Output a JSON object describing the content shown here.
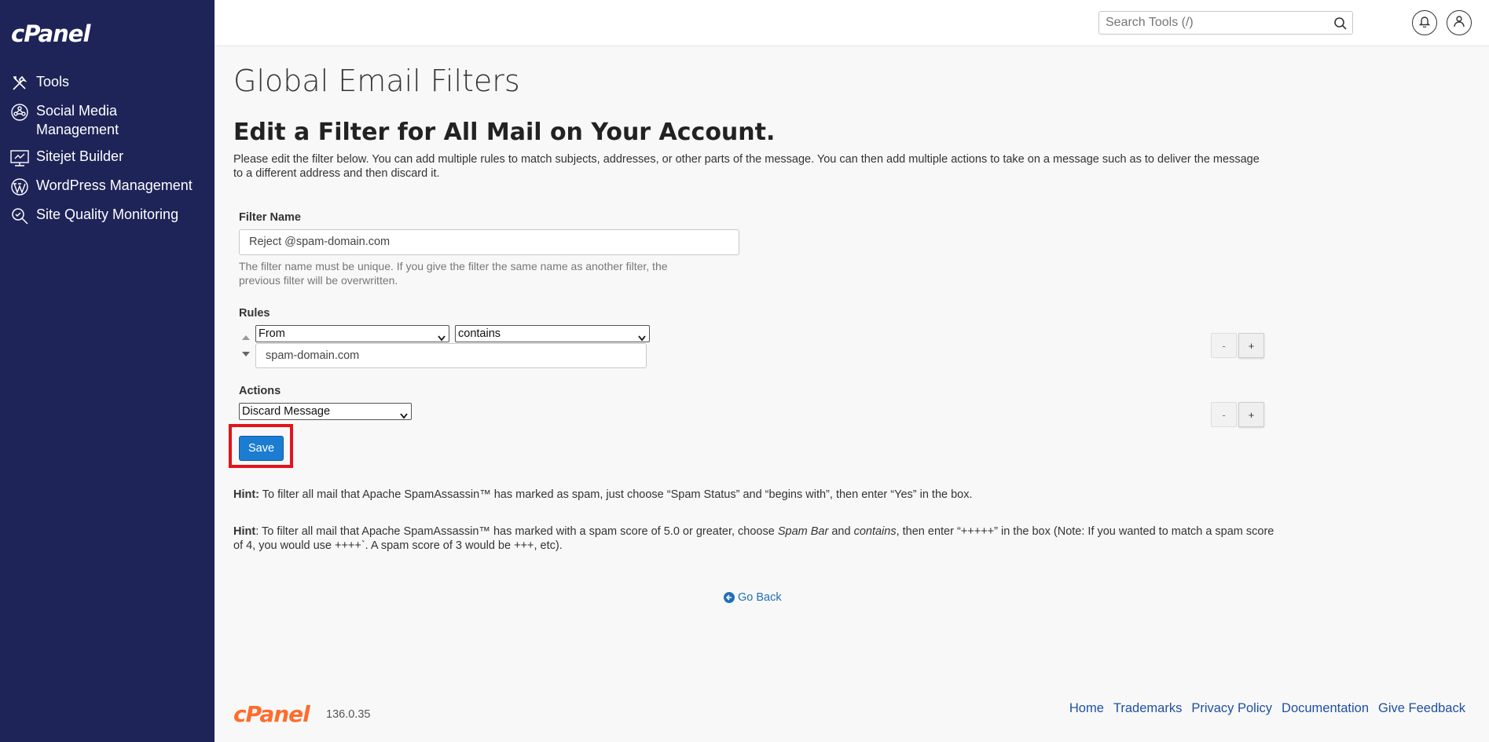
{
  "brand": {
    "logo": "cPanel",
    "version": "136.0.35"
  },
  "sidebar": {
    "items": [
      {
        "label": "Tools",
        "icon": "tools-icon"
      },
      {
        "label": "Social Media Management",
        "icon": "social-media-icon"
      },
      {
        "label": "Sitejet Builder",
        "icon": "sitejet-icon"
      },
      {
        "label": "WordPress Management",
        "icon": "wordpress-icon"
      },
      {
        "label": "Site Quality Monitoring",
        "icon": "site-quality-icon"
      }
    ]
  },
  "header": {
    "search_placeholder": "Search Tools (/)"
  },
  "page": {
    "title": "Global Email Filters",
    "subtitle": "Edit a Filter for All Mail on Your Account.",
    "intro": "Please edit the filter below. You can add multiple rules to match subjects, addresses, or other parts of the message. You can then add multiple actions to take on a message such as to deliver the message to a different address and then discard it."
  },
  "form": {
    "filter_name_label": "Filter Name",
    "filter_name_value": "Reject @spam-domain.com",
    "filter_name_help": "The filter name must be unique. If you give the filter the same name as another filter, the previous filter will be overwritten.",
    "rules_label": "Rules",
    "rule_part": "From",
    "rule_match": "contains",
    "rule_value": "spam-domain.com",
    "actions_label": "Actions",
    "action_value": "Discard Message",
    "minus_label": "-",
    "plus_label": "+",
    "save_label": "Save"
  },
  "hints": {
    "hint1_label": "Hint:",
    "hint1_text": " To filter all mail that Apache SpamAssassin™ has marked as spam, just choose “Spam Status” and “begins with”, then enter “Yes” in the box.",
    "hint2_label": "Hint",
    "hint2_a": ": To filter all mail that Apache SpamAssassin™ has marked with a spam score of 5.0 or greater, choose ",
    "hint2_em1": "Spam Bar",
    "hint2_b": " and ",
    "hint2_em2": "contains",
    "hint2_c": ", then enter “+++++” in the box (Note: If you wanted to match a spam score of 4, you would use ++++`. A spam score of 3 would be +++, etc)."
  },
  "go_back": "Go Back",
  "footer": {
    "links": [
      "Home",
      "Trademarks",
      "Privacy Policy",
      "Documentation",
      "Give Feedback"
    ]
  },
  "colors": {
    "sidebar_bg": "#1e2458",
    "primary_button": "#1b7cd2",
    "highlight_border": "#e3141c",
    "footer_logo": "#ff6c2c"
  }
}
